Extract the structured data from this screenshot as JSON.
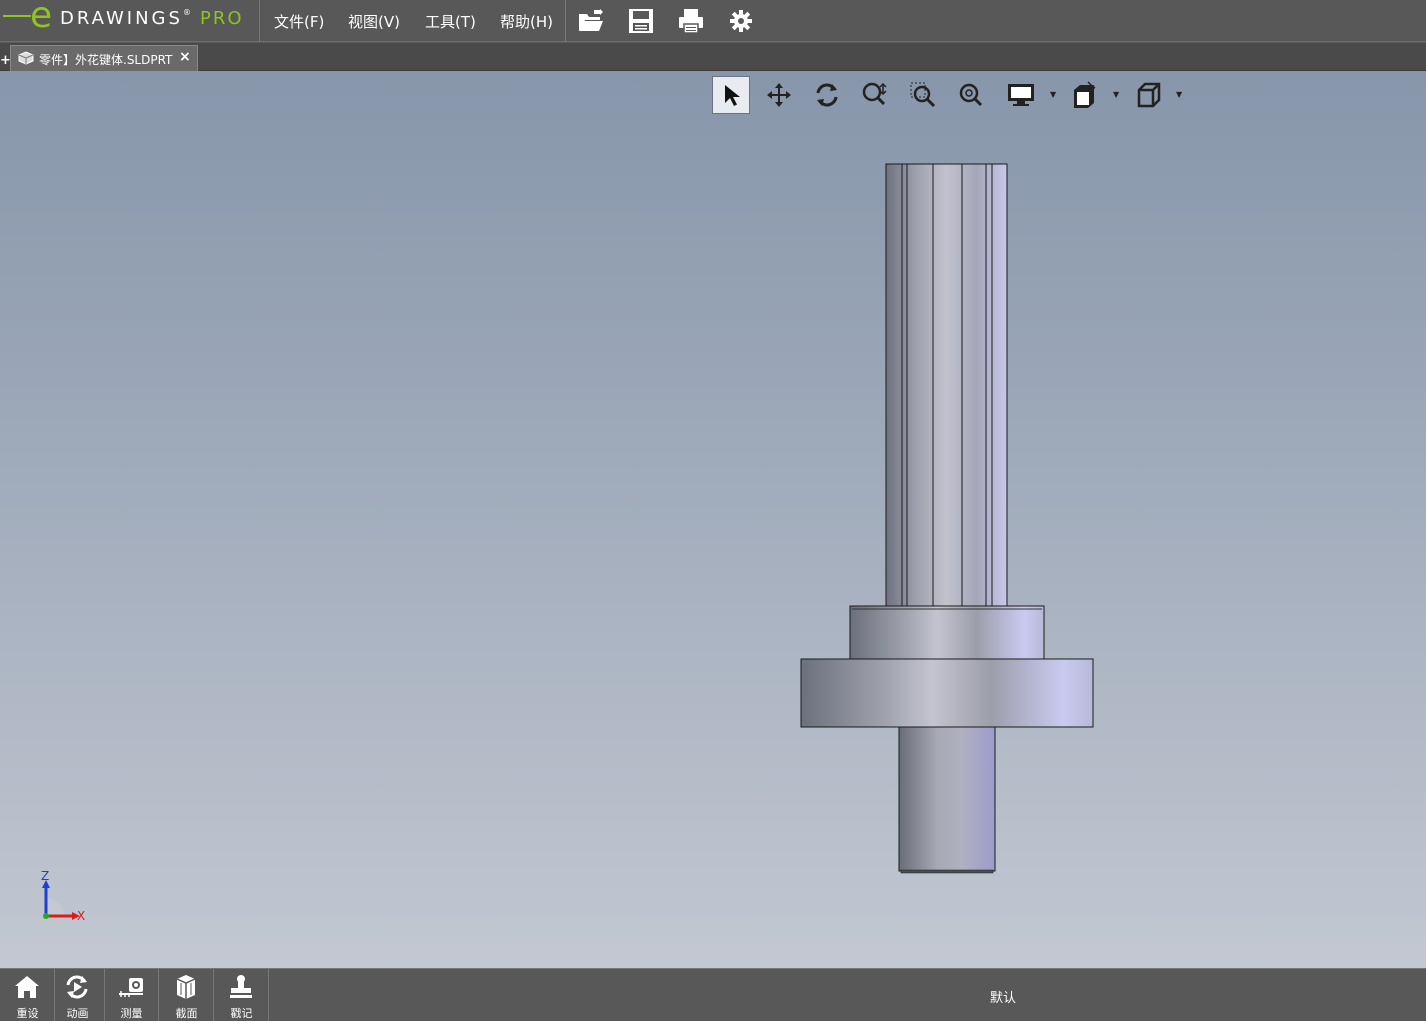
{
  "app": {
    "logo_e": "e",
    "logo_word": "DRAWINGS",
    "logo_reg": "®",
    "logo_pro": "PRO",
    "brand_color": "#8fc31f"
  },
  "menu": {
    "items": [
      "文件(F)",
      "视图(V)",
      "工具(T)",
      "帮助(H)"
    ]
  },
  "toolbar": {
    "icons": [
      "open-icon",
      "save-icon",
      "print-icon",
      "settings-icon"
    ]
  },
  "tabs": {
    "new_tab": "+",
    "document": "零件】外花键体.SLDPRT",
    "close": "×"
  },
  "heads_up": {
    "tools": [
      "select-icon",
      "pan-icon",
      "rotate-icon",
      "zoom-to-fit-icon",
      "zoom-to-area-icon",
      "zoom-icon",
      "display-style-icon",
      "view-settings-icon",
      "view-orientation-icon"
    ]
  },
  "triad": {
    "z": "Z",
    "x": "X"
  },
  "bottom_bar": {
    "buttons": [
      "重设",
      "动画",
      "测量",
      "截面",
      "戳记"
    ],
    "configuration": "默认"
  }
}
